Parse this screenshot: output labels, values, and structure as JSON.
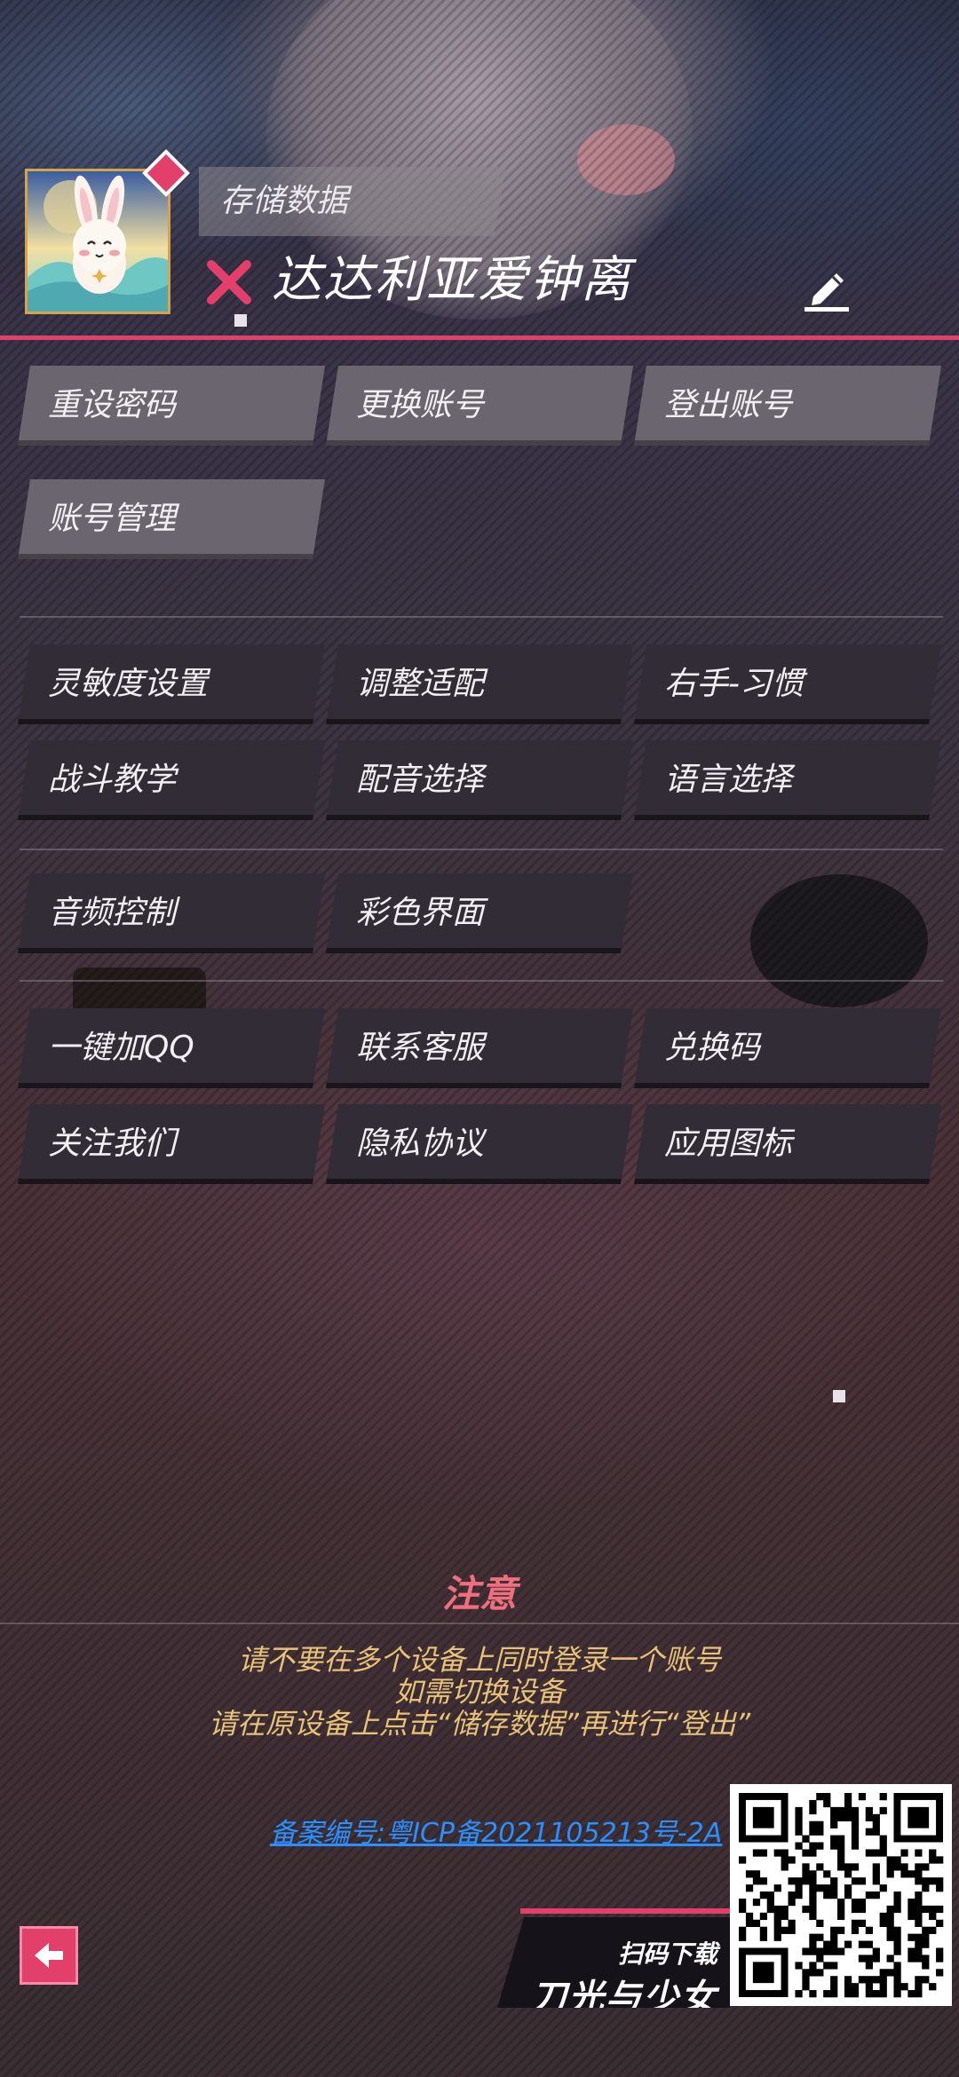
{
  "header": {
    "save_tag": "存储数据",
    "username": "达达利亚爱钟离",
    "colors": {
      "accent": "#e2406a",
      "status_x": "#e2406a"
    }
  },
  "account_buttons": [
    "重设密码",
    "更换账号",
    "登出账号",
    "账号管理"
  ],
  "settings_buttons": [
    "灵敏度设置",
    "调整适配",
    "右手-习惯",
    "战斗教学",
    "配音选择",
    "语言选择"
  ],
  "display_buttons": [
    "音频控制",
    "彩色界面"
  ],
  "misc_buttons": [
    "一键加QQ",
    "联系客服",
    "兑换码",
    "关注我们",
    "隐私协议",
    "应用图标"
  ],
  "notice": {
    "title": "注意",
    "lines": [
      "请不要在多个设备上同时登录一个账号",
      "如需切换设备",
      "请在原设备上点击“储存数据”再进行“登出”"
    ],
    "colors": {
      "title": "#ef6f7f",
      "text": "#e7c27a"
    }
  },
  "footer": {
    "icp": "备案编号:粤ICP备2021105213号-2A",
    "promo_scan": "扫码下载",
    "promo_name": "刀光与少女"
  }
}
